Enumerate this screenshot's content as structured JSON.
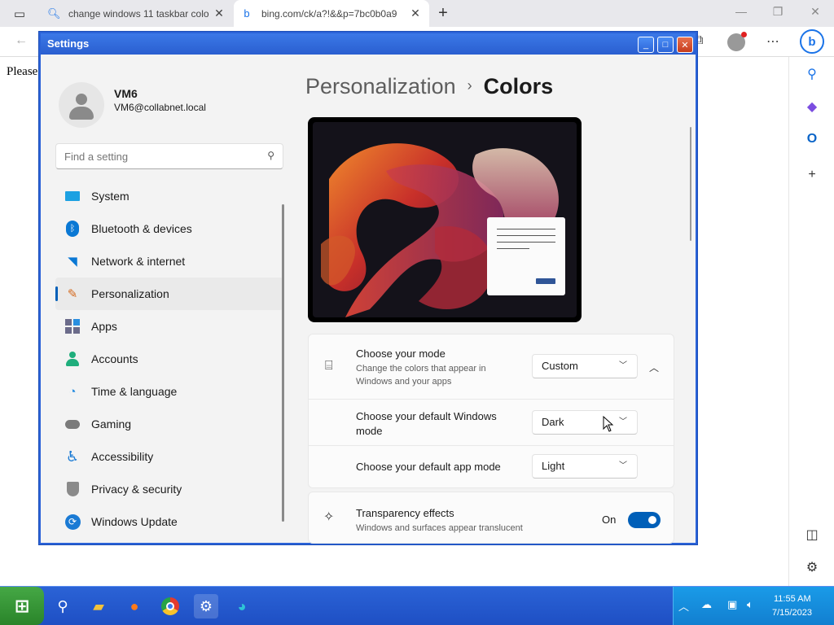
{
  "browser": {
    "tabs": [
      {
        "label": "change windows 11 taskbar colo",
        "icon": "search-icon"
      },
      {
        "label": "bing.com/ck/a?!&&p=7bc0b0a9",
        "icon": "bing-icon"
      }
    ],
    "close_glyph": "✕",
    "new_tab_glyph": "+",
    "page_text": "Please"
  },
  "window": {
    "title": "Settings"
  },
  "user": {
    "name": "VM6",
    "email": "VM6@collabnet.local"
  },
  "search": {
    "placeholder": "Find a setting"
  },
  "nav": {
    "items": [
      {
        "label": "System",
        "icon": "system-icon",
        "active": false
      },
      {
        "label": "Bluetooth & devices",
        "icon": "bluetooth-icon",
        "active": false
      },
      {
        "label": "Network & internet",
        "icon": "wifi-icon",
        "active": false
      },
      {
        "label": "Personalization",
        "icon": "brush-icon",
        "active": true
      },
      {
        "label": "Apps",
        "icon": "apps-icon",
        "active": false
      },
      {
        "label": "Accounts",
        "icon": "accounts-icon",
        "active": false
      },
      {
        "label": "Time & language",
        "icon": "clock-globe-icon",
        "active": false
      },
      {
        "label": "Gaming",
        "icon": "gamepad-icon",
        "active": false
      },
      {
        "label": "Accessibility",
        "icon": "accessibility-icon",
        "active": false
      },
      {
        "label": "Privacy & security",
        "icon": "shield-icon",
        "active": false
      },
      {
        "label": "Windows Update",
        "icon": "update-icon",
        "active": false
      }
    ]
  },
  "breadcrumb": {
    "parent": "Personalization",
    "separator": "›",
    "current": "Colors"
  },
  "mode": {
    "title": "Choose your mode",
    "description": "Change the colors that appear in Windows and your apps",
    "value": "Custom",
    "windows_mode_label": "Choose your default Windows mode",
    "windows_mode_value": "Dark",
    "app_mode_label": "Choose your default app mode",
    "app_mode_value": "Light"
  },
  "transparency": {
    "title": "Transparency effects",
    "description": "Windows and surfaces appear translucent",
    "state_label": "On",
    "enabled": true
  },
  "taskbar": {
    "time": "11:55 AM",
    "date": "7/15/2023"
  },
  "colors": {
    "accent": "#005fb8",
    "title_bar": "#2a5fd0",
    "taskbar": "#1e4fc4",
    "start": "#2a842a"
  }
}
